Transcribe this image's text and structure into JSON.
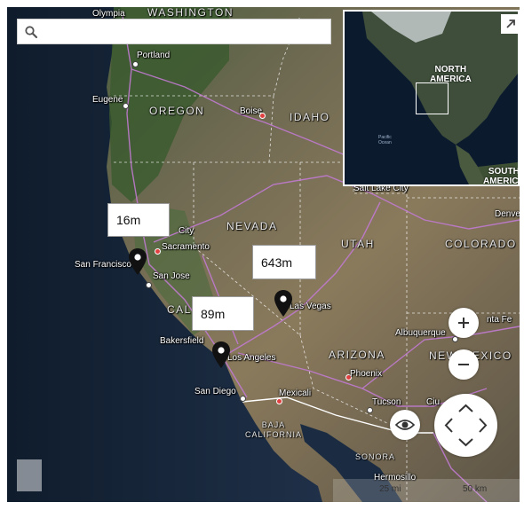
{
  "search": {
    "placeholder": "",
    "value": ""
  },
  "places": {
    "olympia": "Olympia",
    "washington": "WASHINGTON",
    "portland": "Portland",
    "eugene": "Eugene",
    "oregon": "OREGON",
    "boise": "Boise",
    "idaho": "IDAHO",
    "salt_lake_city": "Salt Lake City",
    "denver": "Denve",
    "nevada": "NEVADA",
    "utah": "UTAH",
    "colorado": "COLORADO",
    "sacramento": "Sacramento",
    "city": "City",
    "san_francisco": "San Francisco",
    "san_jose": "San Jose",
    "las_vegas": "Las Vegas",
    "cal": "CAL",
    "bakersfield": "Bakersfield",
    "los_angeles": "Los Angeles",
    "santa_fe": "nta Fe",
    "albuquerque": "Albuquerque",
    "arizona": "ARIZONA",
    "new_mexico": "NEW MEXICO",
    "phoenix": "Phoenix",
    "san_diego": "San Diego",
    "mexicali": "Mexicali",
    "tucson": "Tucson",
    "ciudad": "Ciu",
    "baja_california": "BAJA\nCALIFORNIA",
    "sonora": "SONORA",
    "hermosillo": "Hermosillo"
  },
  "overview_map": {
    "north_america": "NORTH\nAMERICA",
    "south_america": "SOUTH\nAMERICA",
    "pacific_ocean": "Pacific\nOcean"
  },
  "markers": [
    {
      "name": "marker-1",
      "label": "16m"
    },
    {
      "name": "marker-2",
      "label": "643m"
    },
    {
      "name": "marker-3",
      "label": "89m"
    }
  ],
  "scale": {
    "label": "25 mi",
    "label2": "50 km"
  },
  "icons": {
    "search": "search-icon",
    "expand": "expand-icon",
    "zoom_in": "plus-icon",
    "zoom_out": "minus-icon",
    "street_view": "eye-icon",
    "pan": "pan-arrows-icon"
  },
  "colors": {
    "roads": "#c07ad0",
    "border": "#ffffff",
    "water": "#1d2e44",
    "pin": "#111111"
  }
}
